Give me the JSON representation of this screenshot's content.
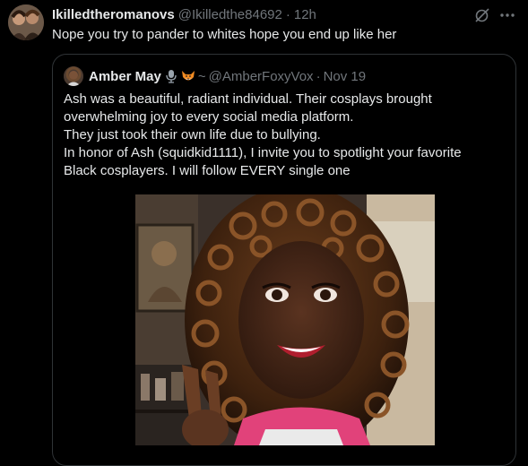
{
  "tweet": {
    "display_name": "Ikilledtheromanovs",
    "handle": "@Ikilledthe84692",
    "separator": "·",
    "time": "12h",
    "text": "Nope you try to pander to whites hope you end up like her",
    "avatar_icon": "avatar-photo",
    "actions": {
      "grok_icon": "grok-slash-icon",
      "more_icon": "more-dots-icon"
    }
  },
  "quote": {
    "display_name": "Amber May",
    "name_emojis": [
      "microphone-icon",
      "fox-icon"
    ],
    "name_suffix": "~",
    "handle": "@AmberFoxyVox",
    "separator": "·",
    "time": "Nov 19",
    "lines": [
      "Ash was a beautiful, radiant individual. Their cosplays brought",
      "overwhelming joy to every social media platform.",
      "They just took their own life due to bullying.",
      "In honor of Ash (squidkid1111), I invite you to spotlight your favorite",
      "Black cosplayers. I will follow EVERY single one"
    ],
    "media_icon": "selfie-photo"
  },
  "colors": {
    "background": "#000000",
    "text_primary": "#e7e9ea",
    "text_secondary": "#71767b",
    "border": "#2f3336"
  }
}
